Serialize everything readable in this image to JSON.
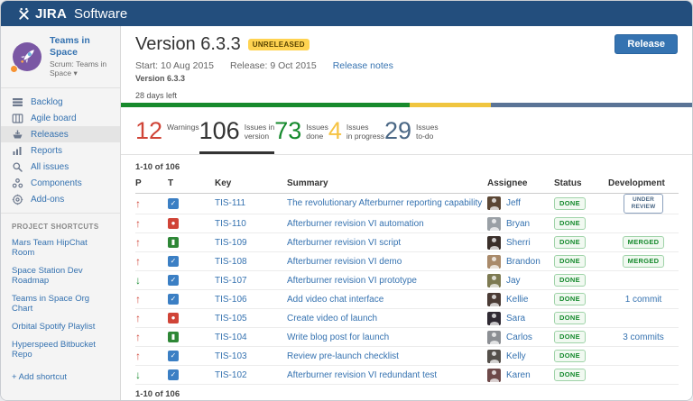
{
  "app": {
    "brand": "JIRA",
    "brand_light": "Software"
  },
  "colors": {
    "topbar": "#234e7d",
    "link": "#3572b0",
    "red": "#d04437",
    "green": "#14892c",
    "yellow": "#f6c342",
    "slate": "#4a6785"
  },
  "sidebar": {
    "project": {
      "name": "Teams in Space",
      "subtitle": "Scrum: Teams in Space ▾"
    },
    "nav": [
      {
        "label": "Backlog",
        "icon": "backlog-icon",
        "selected": false
      },
      {
        "label": "Agile board",
        "icon": "agile-board-icon",
        "selected": false
      },
      {
        "label": "Releases",
        "icon": "releases-icon",
        "selected": true
      },
      {
        "label": "Reports",
        "icon": "reports-icon",
        "selected": false
      },
      {
        "label": "All issues",
        "icon": "all-issues-icon",
        "selected": false
      },
      {
        "label": "Components",
        "icon": "components-icon",
        "selected": false
      },
      {
        "label": "Add-ons",
        "icon": "add-ons-icon",
        "selected": false
      }
    ],
    "shortcuts_heading": "PROJECT SHORTCUTS",
    "shortcuts": [
      {
        "label": "Mars Team HipChat Room"
      },
      {
        "label": "Space Station Dev Roadmap"
      },
      {
        "label": "Teams in Space Org Chart"
      },
      {
        "label": "Orbital Spotify Playlist"
      },
      {
        "label": "Hyperspeed Bitbucket Repo"
      }
    ],
    "add_shortcut": "+ Add shortcut"
  },
  "header": {
    "title": "Version 6.3.3",
    "badge": "UNRELEASED",
    "release_button": "Release",
    "start_label": "Start: 10 Aug 2015",
    "release_label": "Release: 9 Oct 2015",
    "release_notes": "Release notes",
    "subtitle": "Version 6.3.3",
    "days_left": "28 days left"
  },
  "progress": {
    "segments": [
      {
        "name": "done",
        "color": "#178a2c",
        "width": "50.5%"
      },
      {
        "name": "in-progress",
        "color": "#f0c53f",
        "width": "14.2%"
      },
      {
        "name": "to-do",
        "color": "#5a7496",
        "width": "35.3%"
      }
    ]
  },
  "stats": [
    {
      "value": "12",
      "label1": "Warnings",
      "label2": "",
      "color": "#d04437",
      "active": false
    },
    {
      "value": "106",
      "label1": "Issues in",
      "label2": "version",
      "color": "#333333",
      "active": true
    },
    {
      "value": "73",
      "label1": "Issues",
      "label2": "done",
      "color": "#14892c",
      "active": false
    },
    {
      "value": "4",
      "label1": "Issues",
      "label2": "in progress",
      "color": "#f6c342",
      "active": false
    },
    {
      "value": "29",
      "label1": "Issues",
      "label2": "to-do",
      "color": "#4a6785",
      "active": false
    }
  ],
  "table": {
    "pagination_top": "1-10 of 106",
    "pagination_bottom": "1-10 of 106",
    "columns": [
      "P",
      "T",
      "Key",
      "Summary",
      "Assignee",
      "Status",
      "Development"
    ],
    "rows": [
      {
        "priority": {
          "icon_name": "priority-up-icon",
          "glyph": "↑",
          "color": "#d04437"
        },
        "type": {
          "icon_name": "task-icon",
          "glyph": "✓",
          "bg": "#3b7fc4"
        },
        "key": "TIS-111",
        "summary": "The revolutionary Afterburner reporting capability",
        "assignee": {
          "name": "Jeff",
          "avatar_color": "#5b4634"
        },
        "status": "DONE",
        "dev": {
          "kind": "review",
          "text": "UNDER REVIEW"
        }
      },
      {
        "priority": {
          "icon_name": "priority-up-icon",
          "glyph": "↑",
          "color": "#d04437"
        },
        "type": {
          "icon_name": "bug-icon",
          "glyph": "●",
          "bg": "#d04437"
        },
        "key": "TIS-110",
        "summary": "Afterburner revision VI automation",
        "assignee": {
          "name": "Bryan",
          "avatar_color": "#9aa0a6"
        },
        "status": "DONE",
        "dev": {
          "kind": "none",
          "text": ""
        }
      },
      {
        "priority": {
          "icon_name": "priority-up-icon",
          "glyph": "↑",
          "color": "#d04437"
        },
        "type": {
          "icon_name": "story-icon",
          "glyph": "▮",
          "bg": "#2e8736"
        },
        "key": "TIS-109",
        "summary": "Afterburner revision VI script",
        "assignee": {
          "name": "Sherri",
          "avatar_color": "#3a2f2a"
        },
        "status": "DONE",
        "dev": {
          "kind": "merged",
          "text": "MERGED"
        }
      },
      {
        "priority": {
          "icon_name": "priority-up-icon",
          "glyph": "↑",
          "color": "#d04437"
        },
        "type": {
          "icon_name": "task-icon",
          "glyph": "✓",
          "bg": "#3b7fc4"
        },
        "key": "TIS-108",
        "summary": "Afterburner revision VI demo",
        "assignee": {
          "name": "Brandon",
          "avatar_color": "#a98a6a"
        },
        "status": "DONE",
        "dev": {
          "kind": "merged",
          "text": "MERGED"
        }
      },
      {
        "priority": {
          "icon_name": "priority-down-icon",
          "glyph": "↓",
          "color": "#14892c"
        },
        "type": {
          "icon_name": "task-icon",
          "glyph": "✓",
          "bg": "#3b7fc4"
        },
        "key": "TIS-107",
        "summary": "Afterburner revision VI prototype",
        "assignee": {
          "name": "Jay",
          "avatar_color": "#7d7a52"
        },
        "status": "DONE",
        "dev": {
          "kind": "none",
          "text": ""
        }
      },
      {
        "priority": {
          "icon_name": "priority-up-icon",
          "glyph": "↑",
          "color": "#d04437"
        },
        "type": {
          "icon_name": "task-icon",
          "glyph": "✓",
          "bg": "#3b7fc4"
        },
        "key": "TIS-106",
        "summary": "Add video chat interface",
        "assignee": {
          "name": "Kellie",
          "avatar_color": "#4a3b35"
        },
        "status": "DONE",
        "dev": {
          "kind": "link",
          "text": "1 commit"
        }
      },
      {
        "priority": {
          "icon_name": "priority-up-icon",
          "glyph": "↑",
          "color": "#d04437"
        },
        "type": {
          "icon_name": "bug-icon",
          "glyph": "●",
          "bg": "#d04437"
        },
        "key": "TIS-105",
        "summary": "Create video of launch",
        "assignee": {
          "name": "Sara",
          "avatar_color": "#2f2a33"
        },
        "status": "DONE",
        "dev": {
          "kind": "none",
          "text": ""
        }
      },
      {
        "priority": {
          "icon_name": "priority-up-icon",
          "glyph": "↑",
          "color": "#d04437"
        },
        "type": {
          "icon_name": "story-icon",
          "glyph": "▮",
          "bg": "#2e8736"
        },
        "key": "TIS-104",
        "summary": "Write blog post for launch",
        "assignee": {
          "name": "Carlos",
          "avatar_color": "#8c8f94"
        },
        "status": "DONE",
        "dev": {
          "kind": "link",
          "text": "3 commits"
        }
      },
      {
        "priority": {
          "icon_name": "priority-up-icon",
          "glyph": "↑",
          "color": "#d04437"
        },
        "type": {
          "icon_name": "task-icon",
          "glyph": "✓",
          "bg": "#3b7fc4"
        },
        "key": "TIS-103",
        "summary": "Review pre-launch checklist",
        "assignee": {
          "name": "Kelly",
          "avatar_color": "#55504b"
        },
        "status": "DONE",
        "dev": {
          "kind": "none",
          "text": ""
        }
      },
      {
        "priority": {
          "icon_name": "priority-down-icon",
          "glyph": "↓",
          "color": "#14892c"
        },
        "type": {
          "icon_name": "task-icon",
          "glyph": "✓",
          "bg": "#3b7fc4"
        },
        "key": "TIS-102",
        "summary": "Afterburner revision VI redundant test",
        "assignee": {
          "name": "Karen",
          "avatar_color": "#6e4a4a"
        },
        "status": "DONE",
        "dev": {
          "kind": "none",
          "text": ""
        }
      }
    ]
  }
}
